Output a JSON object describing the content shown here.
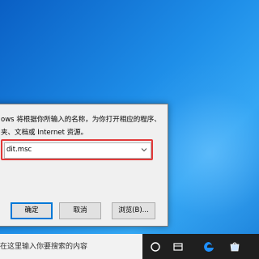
{
  "run_dialog": {
    "description_line1": "ows 将根据你所输入的名称，为你打开相应的程序、",
    "description_line2": "夹、文档或 Internet 资源。",
    "command_value": "dit.msc",
    "ok_label": "确定",
    "cancel_label": "取消",
    "browse_label": "浏览(B)..."
  },
  "taskbar": {
    "search_text": "在这里输入你要搜索的内容",
    "icons": [
      "task-view-icon",
      "folder-icon",
      "edge-icon",
      "store-icon"
    ]
  },
  "colors": {
    "highlight": "#e23a3a",
    "accent": "#0078d7",
    "taskbar": "#1f1f1f"
  }
}
